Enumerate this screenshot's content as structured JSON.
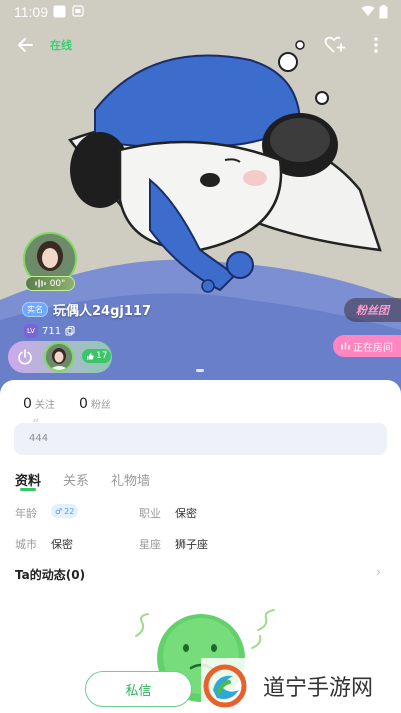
{
  "status_bar": {
    "time": "11:09"
  },
  "top_bar": {
    "online_status": "在线"
  },
  "profile": {
    "voice_duration": "00\"",
    "real_tag": "实名",
    "nickname": "玩偶人24gj117",
    "level_badge": "LV",
    "id_number": "711",
    "fan_count": "17"
  },
  "side_badges": {
    "fans_club": "粉丝团",
    "in_room": "正在房间"
  },
  "stats": [
    {
      "value": "0",
      "label": "关注"
    },
    {
      "value": "0",
      "label": "粉丝"
    }
  ],
  "signature": {
    "quote_mark": "“",
    "text": "444"
  },
  "tabs": [
    {
      "label": "资料",
      "active": true
    },
    {
      "label": "关系",
      "active": false
    },
    {
      "label": "礼物墙",
      "active": false
    }
  ],
  "info": {
    "age_label": "年龄",
    "age_value": "22",
    "gender_icon": "♂",
    "job_label": "职业",
    "job_value": "保密",
    "city_label": "城市",
    "city_value": "保密",
    "zodiac_label": "星座",
    "zodiac_value": "狮子座"
  },
  "moments": {
    "title": "Ta的动态(0)"
  },
  "actions": {
    "private_message": "私信"
  },
  "watermark": {
    "text": "道宁手游网"
  },
  "colors": {
    "accent_green": "#35c766",
    "pink": "#ff86c0",
    "blue_tag": "#6fa8ff"
  }
}
